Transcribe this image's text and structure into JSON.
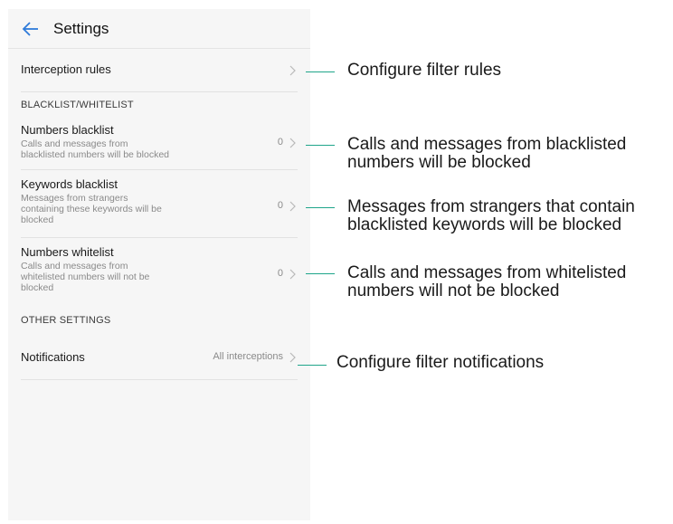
{
  "header": {
    "title": "Settings",
    "back_icon": "arrow-left-icon"
  },
  "accent_color": "#2f7bd9",
  "leader_color": "#1fa58a",
  "rows": {
    "interception": {
      "label": "Interception rules"
    },
    "section_blacklist": "BLACKLIST/WHITELIST",
    "numbers_blacklist": {
      "label": "Numbers blacklist",
      "sub_line1": "Calls and messages from",
      "sub_line2": "blacklisted numbers will be blocked",
      "count": "0"
    },
    "keywords_blacklist": {
      "label": "Keywords blacklist",
      "sub_line1": "Messages from strangers",
      "sub_line2": "containing these keywords will be",
      "sub_line3": "blocked",
      "count": "0"
    },
    "numbers_whitelist": {
      "label": "Numbers whitelist",
      "sub_line1": "Calls and messages from",
      "sub_line2": "whitelisted numbers will not be",
      "sub_line3": "blocked",
      "count": "0"
    },
    "section_other": "OTHER SETTINGS",
    "notifications": {
      "label": "Notifications",
      "value": "All interceptions"
    }
  },
  "callouts": {
    "c1": {
      "line1": "Configure filter rules"
    },
    "c2": {
      "line1": "Calls and messages from blacklisted",
      "line2": "numbers will be blocked"
    },
    "c3": {
      "line1": "Messages from strangers that contain",
      "line2": "blacklisted keywords will be blocked"
    },
    "c4": {
      "line1": "Calls and messages from whitelisted",
      "line2": "numbers will not be blocked"
    },
    "c5": {
      "line1": "Configure filter notifications"
    }
  }
}
